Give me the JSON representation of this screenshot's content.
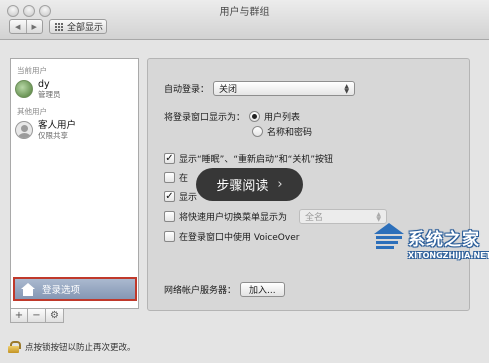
{
  "window": {
    "title": "用户与群组"
  },
  "toolbar": {
    "back_glyph": "◀",
    "forward_glyph": "▶",
    "show_all_label": "全部显示"
  },
  "sidebar": {
    "current_user_section": "当前用户",
    "current_user": {
      "name": "dy",
      "role": "管理员"
    },
    "other_users_section": "其他用户",
    "other_users": [
      {
        "name": "客人用户",
        "role": "仅限共享"
      }
    ],
    "login_options_label": "登录选项",
    "controls": {
      "add": "+",
      "remove": "−",
      "action": "⚙"
    }
  },
  "content": {
    "auto_login": {
      "label": "自动登录：",
      "value": "关闭"
    },
    "login_window_display": {
      "label": "将登录窗口显示为：",
      "options": [
        {
          "label": "用户列表",
          "selected": true
        },
        {
          "label": "名称和密码",
          "selected": false
        }
      ]
    },
    "checkboxes": [
      {
        "label": "显示“睡眠”、“重新启动”和“关机”按钮",
        "checked": true
      },
      {
        "label": "在",
        "checked": false
      },
      {
        "label": "显示",
        "checked": true
      }
    ],
    "fast_user_switch": {
      "label": "将快速用户切换菜单显示为",
      "checked": false,
      "value": "全名"
    },
    "voiceover": {
      "label": "在登录窗口中使用 VoiceOver",
      "checked": false
    },
    "network_server": {
      "label": "网络帐户服务器：",
      "button": "加入..."
    }
  },
  "lock_text": "点按锁按钮以防止再次更改。",
  "overlay": {
    "label": "步骤阅读",
    "chevron": "›"
  },
  "watermark": {
    "title": "系统之家",
    "url": "XITONGZHIJIA.NET"
  },
  "icons": {
    "check_mark": "✓",
    "popup_up": "▲",
    "popup_down": "▼"
  }
}
